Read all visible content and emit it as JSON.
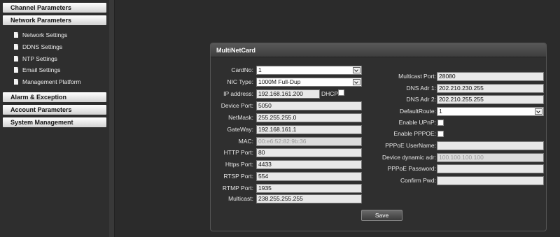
{
  "sidebar": {
    "sections": [
      {
        "label": "Channel Parameters"
      },
      {
        "label": "Network Parameters"
      },
      {
        "label": "Alarm & Exception"
      },
      {
        "label": "Account Parameters"
      },
      {
        "label": "System Management"
      }
    ],
    "network_items": [
      {
        "label": "Network Settings",
        "icon": "document-icon"
      },
      {
        "label": "DDNS Settings",
        "icon": "document-icon"
      },
      {
        "label": "NTP Settings",
        "icon": "document-icon"
      },
      {
        "label": "Email Settings",
        "icon": "document-icon"
      },
      {
        "label": "Management Platform",
        "icon": "document-icon"
      }
    ]
  },
  "panel": {
    "title": "MultiNetCard",
    "save_label": "Save",
    "left": {
      "card_no": {
        "label": "CardNo:",
        "value": "1"
      },
      "nic_type": {
        "label": "NIC Type:",
        "value": "1000M Full-Dup"
      },
      "ip_address": {
        "label": "IP address:",
        "value": "192.168.161.200"
      },
      "dhcp_label": "DHCP",
      "device_port": {
        "label": "Device Port:",
        "value": "5050"
      },
      "netmask": {
        "label": "NetMask:",
        "value": "255.255.255.0"
      },
      "gateway": {
        "label": "GateWay:",
        "value": "192.168.161.1"
      },
      "mac": {
        "label": "MAC:",
        "value": "00:e6:52:82:9b:36"
      },
      "http_port": {
        "label": "HTTP Port:",
        "value": "80"
      },
      "https_port": {
        "label": "Https Port:",
        "value": "4433"
      },
      "rtsp_port": {
        "label": "RTSP Port:",
        "value": "554"
      },
      "rtmp_port": {
        "label": "RTMP Port:",
        "value": "1935"
      },
      "multicast": {
        "label": "Multicast:",
        "value": "238.255.255.255"
      }
    },
    "right": {
      "multicast_port": {
        "label": "Multicast Port:",
        "value": "28080"
      },
      "dns1": {
        "label": "DNS Adr 1:",
        "value": "202.210.230.255"
      },
      "dns2": {
        "label": "DNS Adr 2:",
        "value": "202.210.255.255"
      },
      "default_route": {
        "label": "DefaultRoute:",
        "value": "1"
      },
      "enable_upnp": {
        "label": "Enable UPnP:"
      },
      "enable_pppoe": {
        "label": "Enable PPPOE:"
      },
      "pppoe_user": {
        "label": "PPPoE UserName:",
        "value": ""
      },
      "dynamic_adr": {
        "label": "Device dynamic adr:",
        "value": "100.100.100.100"
      },
      "pppoe_pwd": {
        "label": "PPPoE Password:",
        "value": ""
      },
      "confirm_pwd": {
        "label": "Confirm Pwd:",
        "value": ""
      }
    }
  }
}
